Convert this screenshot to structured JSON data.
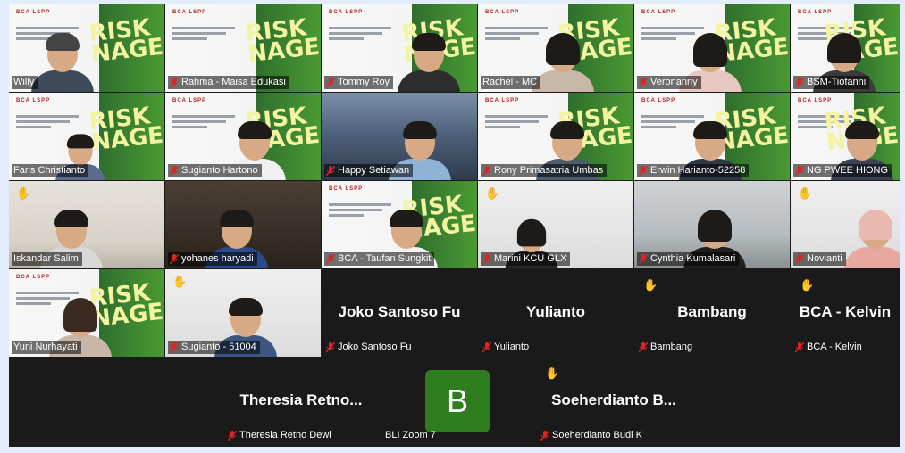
{
  "meeting": {
    "active_speaker": "Rachel - MC",
    "avatar_color": "#2e7d1f",
    "active_border_color": "#39d353",
    "muted_icon": "mic-muted-icon",
    "raised_hand_icon": "raised-hand-icon"
  },
  "slide": {
    "logos": "BCA  LSPP",
    "bigword": "RISK\nNAGE"
  },
  "participants": [
    {
      "name": "Willy",
      "muted": false
    },
    {
      "name": "Rahma - Maisa Edukasi",
      "muted": true
    },
    {
      "name": "Tommy Roy",
      "muted": true
    },
    {
      "name": "Rachel - MC",
      "muted": false
    },
    {
      "name": "Veronanny",
      "muted": true
    },
    {
      "name": "BSM-Tiofanni",
      "muted": true
    },
    {
      "name": "Faris Christianto",
      "muted": false
    },
    {
      "name": "Sugianto Hartono",
      "muted": true
    },
    {
      "name": "Happy Setiawan",
      "muted": true
    },
    {
      "name": "Rony Primasatria Umbas",
      "muted": true
    },
    {
      "name": "Erwin Harianto-52258",
      "muted": true
    },
    {
      "name": "NG PWEE HIONG",
      "muted": true
    },
    {
      "name": "Iskandar Salim",
      "muted": false
    },
    {
      "name": "yohanes haryadi",
      "muted": true
    },
    {
      "name": "BCA - Taufan Sungkit",
      "muted": true
    },
    {
      "name": "Marini KCU GLX",
      "muted": true
    },
    {
      "name": "Cynthia Kumalasari",
      "muted": true
    },
    {
      "name": "Novianti",
      "muted": true
    },
    {
      "name": "Yuni Nurhayati",
      "muted": false
    },
    {
      "name": "Sugianto - 51004",
      "muted": true
    },
    {
      "name": "Joko Santoso Fu",
      "display": "Joko Santoso Fu",
      "muted": true
    },
    {
      "name": "Yulianto",
      "display": "Yulianto",
      "muted": true
    },
    {
      "name": "Bambang",
      "display": "Bambang",
      "muted": true
    },
    {
      "name": "BCA - Kelvin",
      "display": "BCA - Kelvin",
      "muted": true
    },
    {
      "name": "Theresia Retno Dewi",
      "display": "Theresia  Retno...",
      "muted": true
    },
    {
      "name": "BLI Zoom 7",
      "avatar": "B",
      "muted": false
    },
    {
      "name": "Soeherdianto Budi K",
      "display": "Soeherdianto  B...",
      "muted": true
    }
  ]
}
